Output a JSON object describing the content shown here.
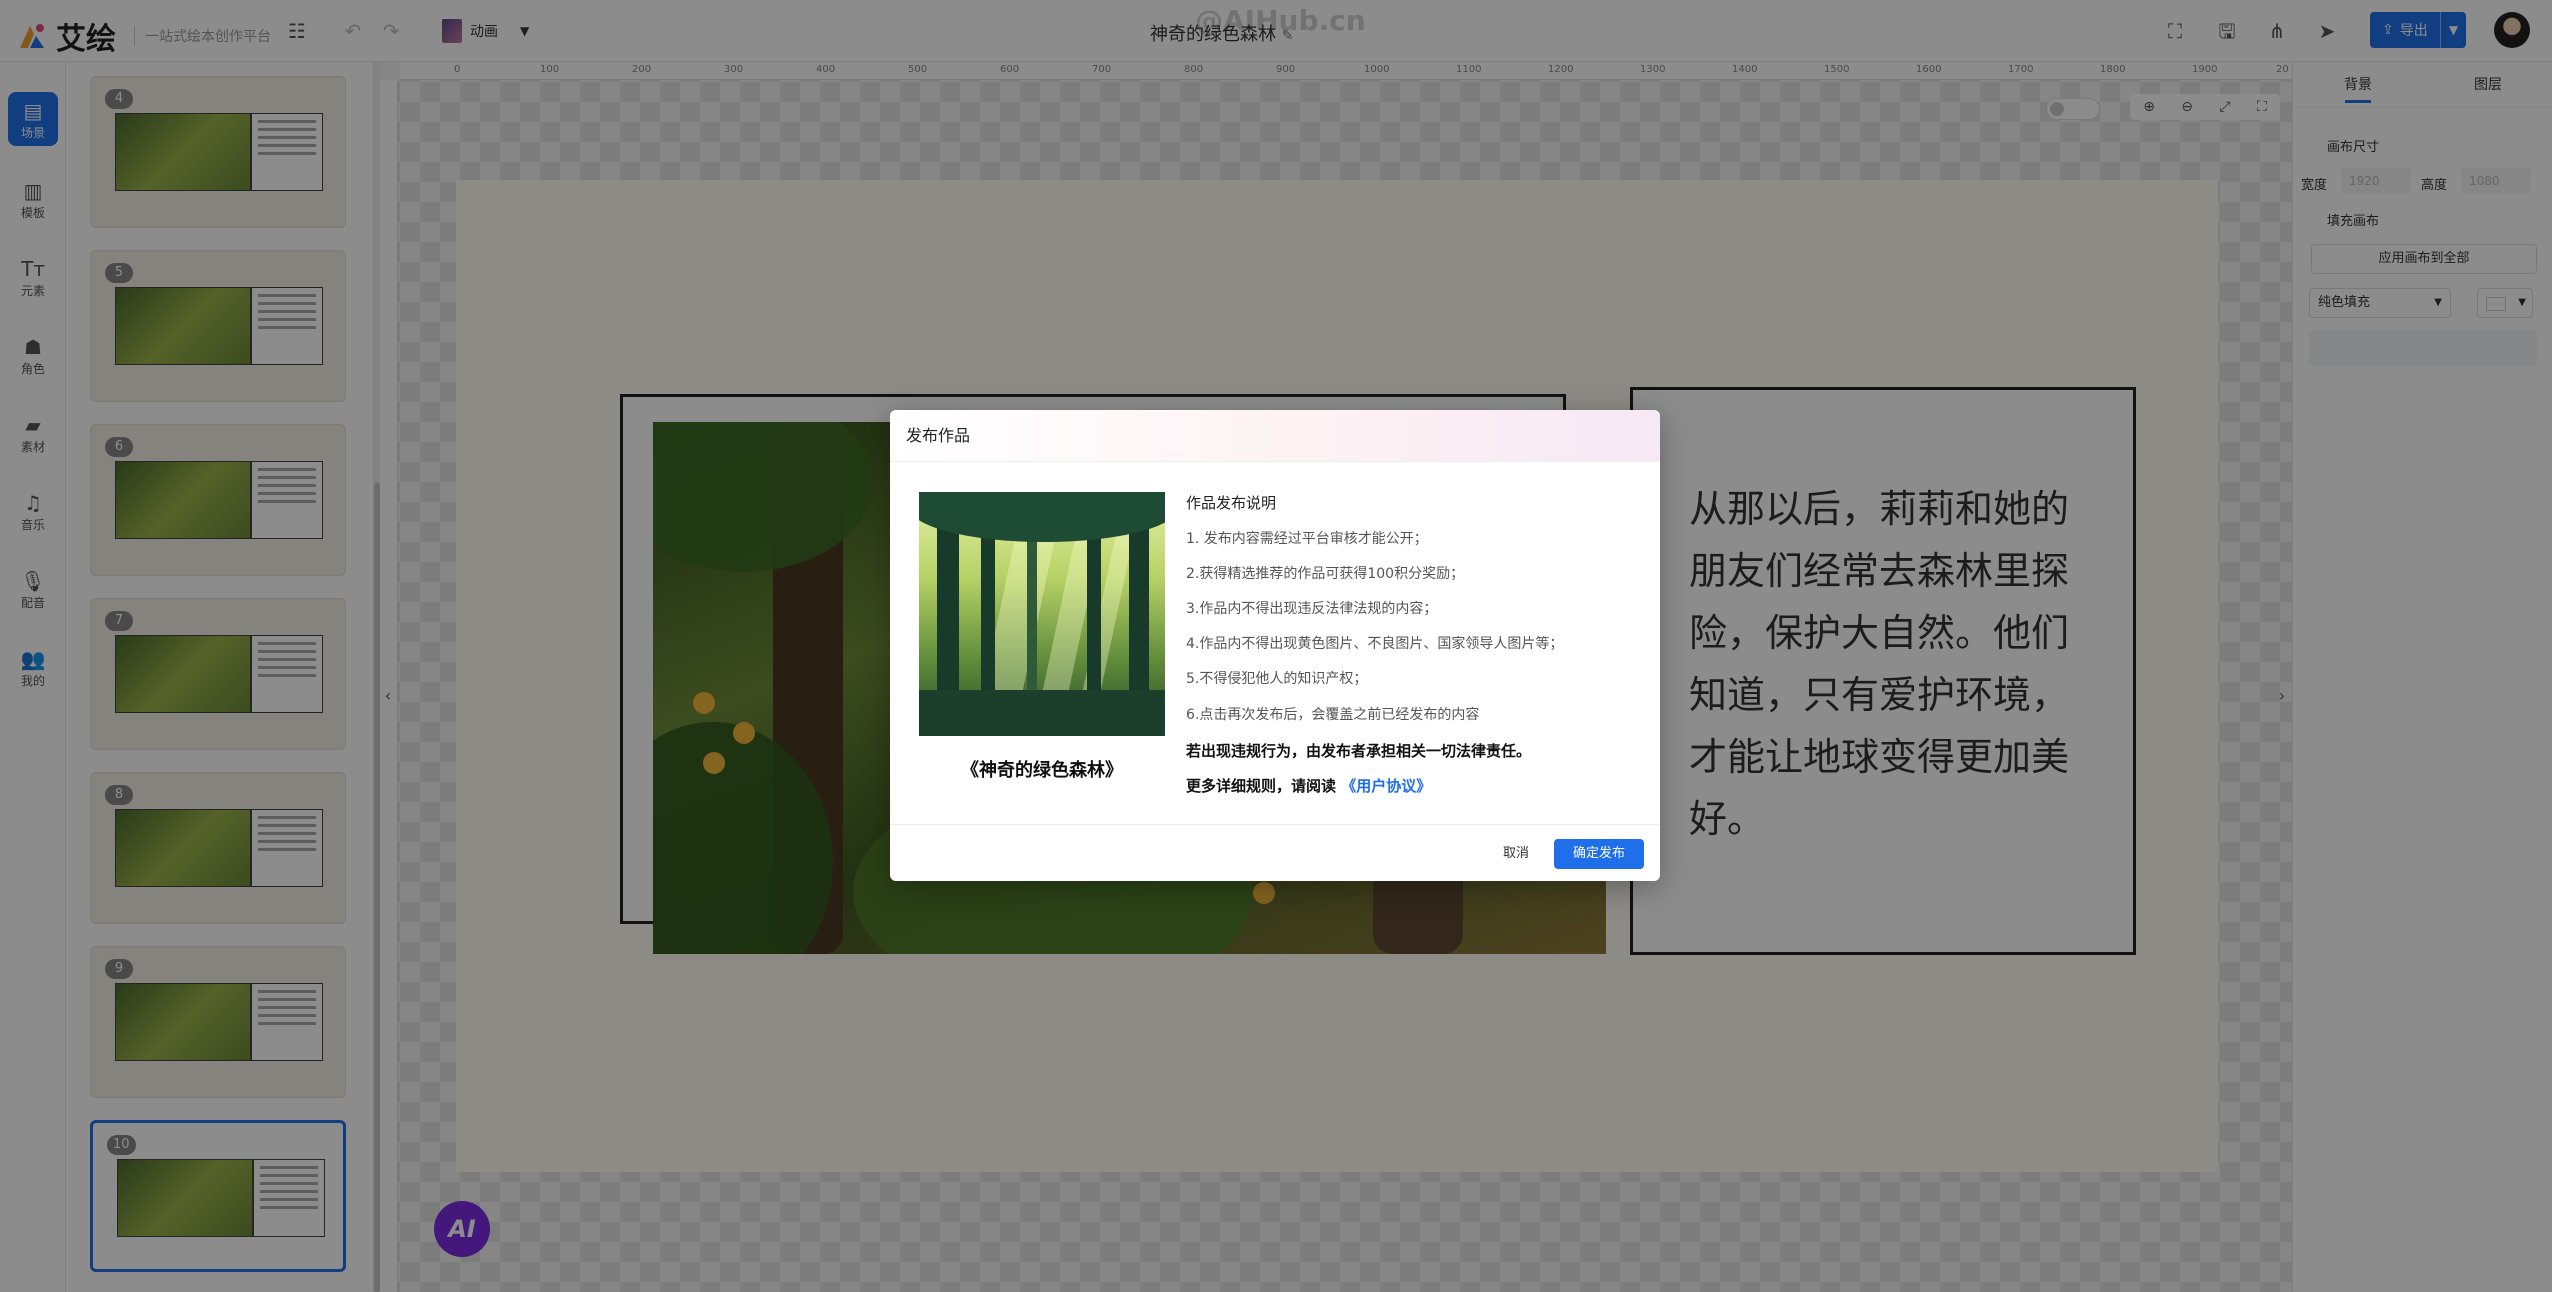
{
  "app": {
    "name": "艾绘",
    "slogan": "一站式绘本创作平台",
    "watermark": "@AIHub.cn"
  },
  "toolbar": {
    "animation_label": "动画",
    "document_title": "神奇的绿色森林",
    "export_label": "导出"
  },
  "nav": [
    {
      "label": "场景",
      "icon": "scene-icon"
    },
    {
      "label": "模板",
      "icon": "template-icon"
    },
    {
      "label": "元素",
      "icon": "text-element-icon"
    },
    {
      "label": "角色",
      "icon": "character-icon"
    },
    {
      "label": "素材",
      "icon": "folder-icon"
    },
    {
      "label": "音乐",
      "icon": "music-icon"
    },
    {
      "label": "配音",
      "icon": "microphone-icon"
    },
    {
      "label": "我的",
      "icon": "users-icon"
    }
  ],
  "slides": [
    "4",
    "5",
    "6",
    "7",
    "8",
    "9",
    "10"
  ],
  "ruler": [
    "0",
    "100",
    "200",
    "300",
    "400",
    "500",
    "600",
    "700",
    "800",
    "900",
    "1000",
    "1100",
    "1200",
    "1300",
    "1400",
    "1500",
    "1600",
    "1700",
    "1800",
    "1900",
    "20"
  ],
  "canvas": {
    "story_text": "从那以后，莉莉和她的朋友们经常去森林里探险，保护大自然。他们知道，只有爱护环境，才能让地球变得更加美好。",
    "ai_label": "AI"
  },
  "right_panel": {
    "tabs": [
      "背景",
      "图层"
    ],
    "canvas_size_label": "画布尺寸",
    "width_label": "宽度",
    "height_label": "高度",
    "width_value": "1920",
    "height_value": "1080",
    "fill_canvas_label": "填充画布",
    "apply_all_label": "应用画布到全部",
    "fill_type": "纯色填充"
  },
  "dialog": {
    "title": "发布作品",
    "book_title": "《神奇的绿色森林》",
    "heading": "作品发布说明",
    "rules": [
      "1. 发布内容需经过平台审核才能公开；",
      "2.获得精选推荐的作品可获得100积分奖励；",
      "3.作品内不得出现违反法律法规的内容；",
      "4.作品内不得出现黄色图片、不良图片、国家领导人图片等；",
      "5.不得侵犯他人的知识产权；",
      "6.点击再次发布后，会覆盖之前已经发布的内容"
    ],
    "warning": "若出现违规行为，由发布者承担相关一切法律责任。",
    "more_prefix": "更多详细规则，请阅读",
    "agreement_link": "《用户协议》",
    "cancel_label": "取消",
    "confirm_label": "确定发布"
  },
  "colors": {
    "primary": "#1f6feb",
    "ai_button": "#7a2be0",
    "overlay": "rgba(0,0,0,0.45)"
  }
}
